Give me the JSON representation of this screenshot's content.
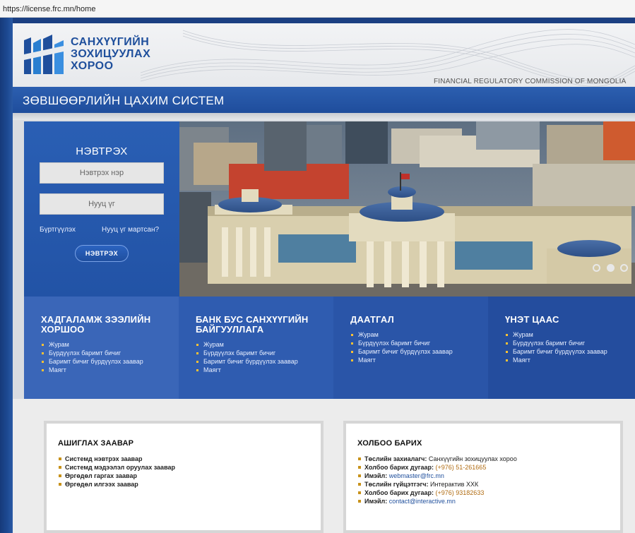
{
  "browser": {
    "url": "https://license.frc.mn/home"
  },
  "header": {
    "logo_lines": [
      "САНХҮҮГИЙН",
      "ЗОХИЦУУЛАХ",
      "ХОРОО"
    ],
    "subtitle_en": "FINANCIAL REGULATORY COMMISSION OF MONGOLIA"
  },
  "titlebar": {
    "title": "ЗӨВШӨӨРЛИЙН ЦАХИМ СИСТЕМ"
  },
  "login": {
    "title": "НЭВТРЭХ",
    "username_placeholder": "Нэвтрэх нэр",
    "password_placeholder": "Нууц үг",
    "register_link": "Бүртгүүлэх",
    "forgot_link": "Нууц үг мартсан?",
    "submit_label": "НЭВТРЭХ"
  },
  "slider": {
    "slides": 3,
    "active_index": 1
  },
  "tiles": [
    {
      "title_lines": [
        "ХАДГАЛАМЖ ЗЭЭЛИЙН",
        "ХОРШОО"
      ],
      "items": [
        "Журам",
        "Бүрдүүлэх баримт бичиг",
        "Баримт бичиг бүрдүүлэх заавар",
        "Маягт"
      ],
      "bg": "#3a66b8"
    },
    {
      "title_lines": [
        "БАНК БУС САНХҮҮГИЙН",
        "БАЙГУУЛЛАГА"
      ],
      "items": [
        "Журам",
        "Бүрдүүлэх баримт бичиг",
        "Баримт бичиг бүрдүүлэх заавар",
        "Маягт"
      ],
      "bg": "#2f5cb0"
    },
    {
      "title_lines": [
        "ДААТГАЛ"
      ],
      "items": [
        "Журам",
        "Бүрдүүлэх баримт бичиг",
        "Баримт бичиг бүрдүүлэх заавар",
        "Маягт"
      ],
      "bg": "#2a55a8"
    },
    {
      "title_lines": [
        "ҮНЭТ ЦААС"
      ],
      "items": [
        "Журам",
        "Бүрдүүлэх баримт бичиг",
        "Баримт бичиг бүрдүүлэх заавар",
        "Маягт"
      ],
      "bg": "#244d9e"
    }
  ],
  "guide": {
    "title": "АШИГЛАХ ЗААВАР",
    "items": [
      "Системд нэвтрэх заавар",
      "Системд мэдээлэл оруулах заавар",
      "Өргөдөл гаргах заавар",
      "Өргөдөл илгээх заавар"
    ]
  },
  "contact": {
    "title": "ХОЛБОО БАРИХ",
    "rows": [
      {
        "label": "Төслийн захиалагч:",
        "value": "Санхүүгийн зохицуулах хороо",
        "style": "v"
      },
      {
        "label": "Холбоо барих дугаар:",
        "value": "(+976) 51-261665",
        "style": "o"
      },
      {
        "label": "Имэйл:",
        "value": "webmaster@frc.mn",
        "style": "b"
      },
      {
        "label": "Төслийн гүйцэтгэгч:",
        "value": "Интерактив ХХК",
        "style": "v"
      },
      {
        "label": "Холбоо барих дугаар:",
        "value": "(+976) 93182633",
        "style": "o"
      },
      {
        "label": "Имэйл:",
        "value": "contact@interactive.mn",
        "style": "b"
      }
    ]
  },
  "colors": {
    "brand_blue": "#1f4f9c",
    "accent_yellow": "#ffc233"
  }
}
